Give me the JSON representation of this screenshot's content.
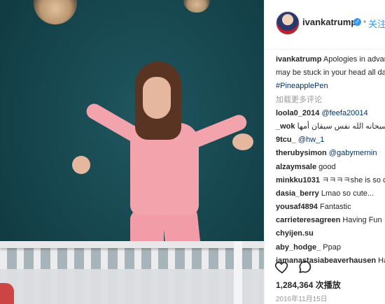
{
  "account": {
    "username": "ivankatrump",
    "follow_label": "关注",
    "dot": "•",
    "verified_mark": "✓"
  },
  "caption": {
    "username": "ivankatrump",
    "text": "Apologies in advance",
    "line2": "may be stuck in your head all day",
    "hashtag": "#PineapplePen"
  },
  "load_more": "加载更多评论",
  "comments": [
    {
      "user": "loola0_2014",
      "text": "@feefa20014",
      "kind": "mention"
    },
    {
      "user": "_wok",
      "text": "سبحانه الله نفس سيقان أمها",
      "kind": "text"
    },
    {
      "user": "9tcu_",
      "text": "@hw_1",
      "kind": "mention"
    },
    {
      "user": "therubysimon",
      "text": "@gabymernin",
      "kind": "mention"
    },
    {
      "user": "alzaymsale",
      "text": "good",
      "kind": "text"
    },
    {
      "user": "minkku1031",
      "text": "ㅋㅋㅋㅋshe is so cute",
      "kind": "text"
    },
    {
      "user": "dasia_berry",
      "text": "Lmao so cute...",
      "kind": "text"
    },
    {
      "user": "yousaf4894",
      "text": "Fantastic",
      "kind": "text"
    },
    {
      "user": "carrieteresagreen",
      "text": "Having Fun",
      "kind": "text"
    },
    {
      "user": "chyijen.su",
      "text": "",
      "kind": "text"
    },
    {
      "user": "aby_hodge_",
      "text": "Ppap",
      "kind": "text"
    },
    {
      "user": "iamanastasiabeaverhausen",
      "text": "Hah",
      "kind": "text"
    }
  ],
  "views": "1,284,364 次播放",
  "date": "2016年11月15日",
  "icons": [
    "heart-icon",
    "comment-icon"
  ]
}
